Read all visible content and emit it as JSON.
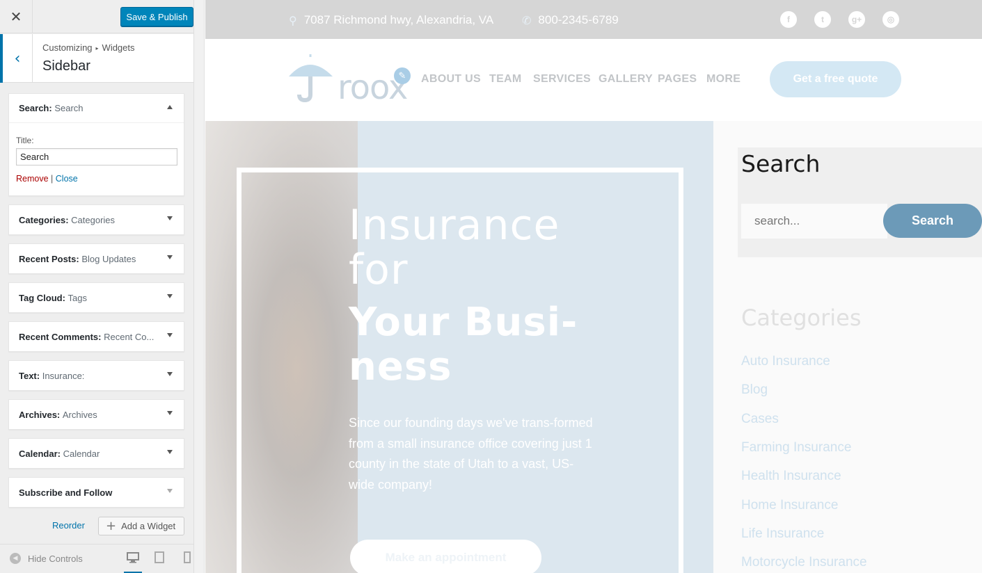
{
  "customizer": {
    "close_icon": "close-icon",
    "save_label": "Save & Publish",
    "breadcrumb": [
      "Customizing",
      "Widgets"
    ],
    "section_title": "Sidebar",
    "widgets": [
      {
        "type": "Search",
        "name": "Search",
        "expanded": true
      },
      {
        "type": "Categories",
        "name": "Categories"
      },
      {
        "type": "Recent Posts",
        "name": "Blog Updates"
      },
      {
        "type": "Tag Cloud",
        "name": "Tags"
      },
      {
        "type": "Recent Comments",
        "name": "Recent Co..."
      },
      {
        "type": "Text",
        "name": "Insurance:"
      },
      {
        "type": "Archives",
        "name": "Archives"
      },
      {
        "type": "Calendar",
        "name": "Calendar"
      },
      {
        "type": "Subscribe and Follow",
        "name": ""
      }
    ],
    "search_widget": {
      "title_label": "Title:",
      "title_value": "Search",
      "remove_label": "Remove",
      "separator": "|",
      "close_label": "Close"
    },
    "reorder_label": "Reorder",
    "add_widget_label": "Add a Widget",
    "hide_controls_label": "Hide Controls",
    "accent": "#0073aa",
    "save_color": "#0085ba"
  },
  "preview": {
    "address": "7087 Richmond hwy, Alexandria, VA",
    "phone": "800-2345-6789",
    "social": [
      "facebook-icon",
      "twitter-icon",
      "google-plus-icon",
      "instagram-icon"
    ],
    "social_glyphs": [
      "f",
      "t",
      "g+",
      "◎"
    ],
    "logo_text": "roox",
    "nav": [
      "ABOUT US",
      "TEAM",
      "SERVICES",
      "GALLERY",
      "PAGES",
      "MORE"
    ],
    "quote_button": "Get a free quote",
    "hero": {
      "line1": "Insurance",
      "line2": "for",
      "line3": "Your Busi-",
      "line4": "ness",
      "paragraph": "Since our founding days we've trans-formed from a small insurance office covering just 1 county in the state of Utah to a vast, US-wide company!",
      "button": "Make an appointment"
    },
    "sidebar": {
      "search_title": "Search",
      "search_placeholder": "search...",
      "search_button": "Search",
      "categories_title": "Categories",
      "categories": [
        "Auto Insurance",
        "Blog",
        "Cases",
        "Farming Insurance",
        "Health Insurance",
        "Home Insurance",
        "Life Insurance",
        "Motorcycle Insurance"
      ]
    },
    "brand_color": "#6c9ab8"
  }
}
